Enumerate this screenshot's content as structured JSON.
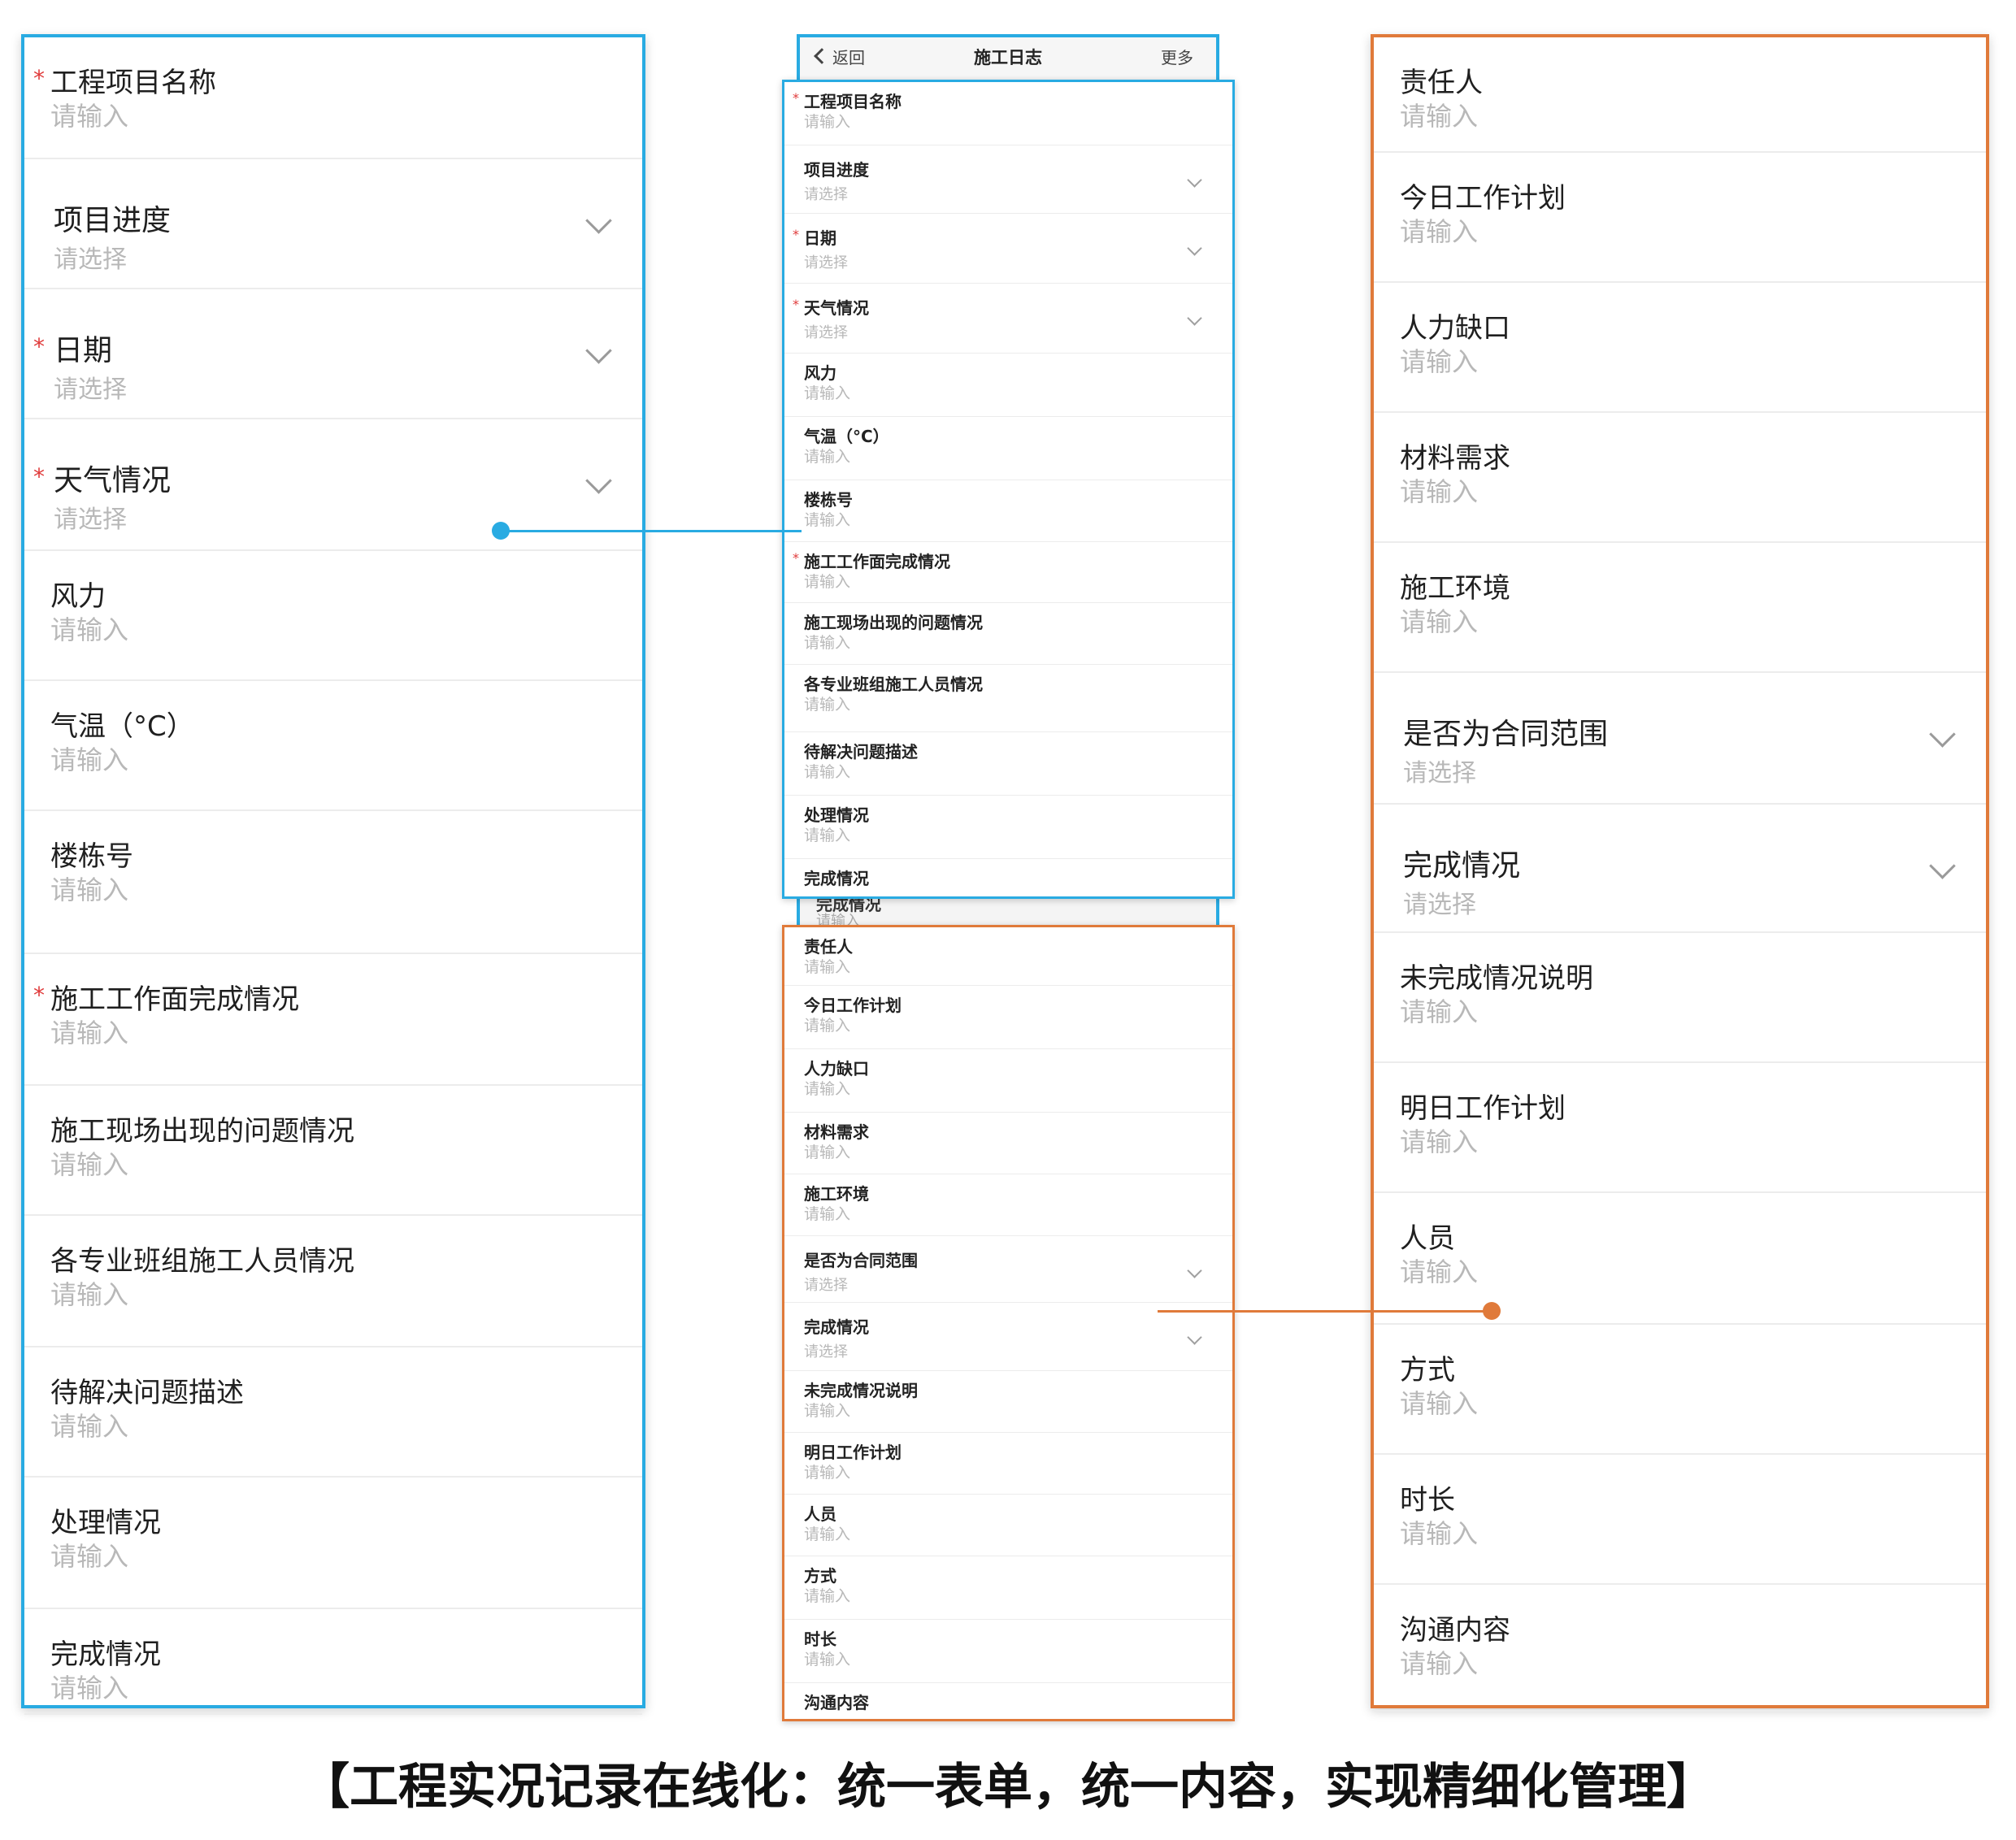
{
  "left_panel": {
    "rows": [
      {
        "label": "工程项目名称",
        "placeholder": "请输入",
        "required": true,
        "select": false
      },
      {
        "label": "项目进度",
        "placeholder": "请选择",
        "required": false,
        "select": true
      },
      {
        "label": "日期",
        "placeholder": "请选择",
        "required": true,
        "select": true
      },
      {
        "label": "天气情况",
        "placeholder": "请选择",
        "required": true,
        "select": true
      },
      {
        "label": "风力",
        "placeholder": "请输入",
        "required": false,
        "select": false
      },
      {
        "label": "气温（°C）",
        "placeholder": "请输入",
        "required": false,
        "select": false
      },
      {
        "label": "楼栋号",
        "placeholder": "请输入",
        "required": false,
        "select": false
      },
      {
        "label": "施工工作面完成情况",
        "placeholder": "请输入",
        "required": true,
        "select": false
      },
      {
        "label": "施工现场出现的问题情况",
        "placeholder": "请输入",
        "required": false,
        "select": false
      },
      {
        "label": "各专业班组施工人员情况",
        "placeholder": "请输入",
        "required": false,
        "select": false
      },
      {
        "label": "待解决问题描述",
        "placeholder": "请输入",
        "required": false,
        "select": false
      },
      {
        "label": "处理情况",
        "placeholder": "请输入",
        "required": false,
        "select": false
      },
      {
        "label": "完成情况",
        "placeholder": "请输入",
        "required": false,
        "select": false
      }
    ]
  },
  "phone": {
    "nav": {
      "back_label": "返回",
      "title": "施工日志",
      "more_label": "更多"
    },
    "ghost_row": {
      "label": "完成情况",
      "placeholder": "请输入"
    }
  },
  "mini_top": {
    "rows": [
      {
        "label": "工程项目名称",
        "placeholder": "请输入",
        "required": true,
        "select": false
      },
      {
        "label": "项目进度",
        "placeholder": "请选择",
        "required": false,
        "select": true
      },
      {
        "label": "日期",
        "placeholder": "请选择",
        "required": true,
        "select": true
      },
      {
        "label": "天气情况",
        "placeholder": "请选择",
        "required": true,
        "select": true
      },
      {
        "label": "风力",
        "placeholder": "请输入",
        "required": false,
        "select": false
      },
      {
        "label": "气温（°C）",
        "placeholder": "请输入",
        "required": false,
        "select": false
      },
      {
        "label": "楼栋号",
        "placeholder": "请输入",
        "required": false,
        "select": false
      },
      {
        "label": "施工工作面完成情况",
        "placeholder": "请输入",
        "required": true,
        "select": false
      },
      {
        "label": "施工现场出现的问题情况",
        "placeholder": "请输入",
        "required": false,
        "select": false
      },
      {
        "label": "各专业班组施工人员情况",
        "placeholder": "请输入",
        "required": false,
        "select": false
      },
      {
        "label": "待解决问题描述",
        "placeholder": "请输入",
        "required": false,
        "select": false
      },
      {
        "label": "处理情况",
        "placeholder": "请输入",
        "required": false,
        "select": false
      },
      {
        "label": "完成情况",
        "placeholder": "",
        "required": false,
        "select": false
      }
    ]
  },
  "mini_bottom": {
    "rows": [
      {
        "label": "责任人",
        "placeholder": "请输入",
        "required": false,
        "select": false
      },
      {
        "label": "今日工作计划",
        "placeholder": "请输入",
        "required": false,
        "select": false
      },
      {
        "label": "人力缺口",
        "placeholder": "请输入",
        "required": false,
        "select": false
      },
      {
        "label": "材料需求",
        "placeholder": "请输入",
        "required": false,
        "select": false
      },
      {
        "label": "施工环境",
        "placeholder": "请输入",
        "required": false,
        "select": false
      },
      {
        "label": "是否为合同范围",
        "placeholder": "请选择",
        "required": false,
        "select": true
      },
      {
        "label": "完成情况",
        "placeholder": "请选择",
        "required": false,
        "select": true
      },
      {
        "label": "未完成情况说明",
        "placeholder": "请输入",
        "required": false,
        "select": false
      },
      {
        "label": "明日工作计划",
        "placeholder": "请输入",
        "required": false,
        "select": false
      },
      {
        "label": "人员",
        "placeholder": "请输入",
        "required": false,
        "select": false
      },
      {
        "label": "方式",
        "placeholder": "请输入",
        "required": false,
        "select": false
      },
      {
        "label": "时长",
        "placeholder": "请输入",
        "required": false,
        "select": false
      },
      {
        "label": "沟通内容",
        "placeholder": "",
        "required": false,
        "select": false
      }
    ]
  },
  "right_panel": {
    "rows": [
      {
        "label": "责任人",
        "placeholder": "请输入",
        "required": false,
        "select": false
      },
      {
        "label": "今日工作计划",
        "placeholder": "请输入",
        "required": false,
        "select": false
      },
      {
        "label": "人力缺口",
        "placeholder": "请输入",
        "required": false,
        "select": false
      },
      {
        "label": "材料需求",
        "placeholder": "请输入",
        "required": false,
        "select": false
      },
      {
        "label": "施工环境",
        "placeholder": "请输入",
        "required": false,
        "select": false
      },
      {
        "label": "是否为合同范围",
        "placeholder": "请选择",
        "required": false,
        "select": true
      },
      {
        "label": "完成情况",
        "placeholder": "请选择",
        "required": false,
        "select": true
      },
      {
        "label": "未完成情况说明",
        "placeholder": "请输入",
        "required": false,
        "select": false
      },
      {
        "label": "明日工作计划",
        "placeholder": "请输入",
        "required": false,
        "select": false
      },
      {
        "label": "人员",
        "placeholder": "请输入",
        "required": false,
        "select": false
      },
      {
        "label": "方式",
        "placeholder": "请输入",
        "required": false,
        "select": false
      },
      {
        "label": "时长",
        "placeholder": "请输入",
        "required": false,
        "select": false
      },
      {
        "label": "沟通内容",
        "placeholder": "请输入",
        "required": false,
        "select": false
      }
    ]
  },
  "colors": {
    "blue_accent": "#29abe2",
    "orange_accent": "#e07a3a",
    "required_star": "#e03b3b"
  },
  "caption": "【工程实况记录在线化：统一表单，统一内容，实现精细化管理】"
}
